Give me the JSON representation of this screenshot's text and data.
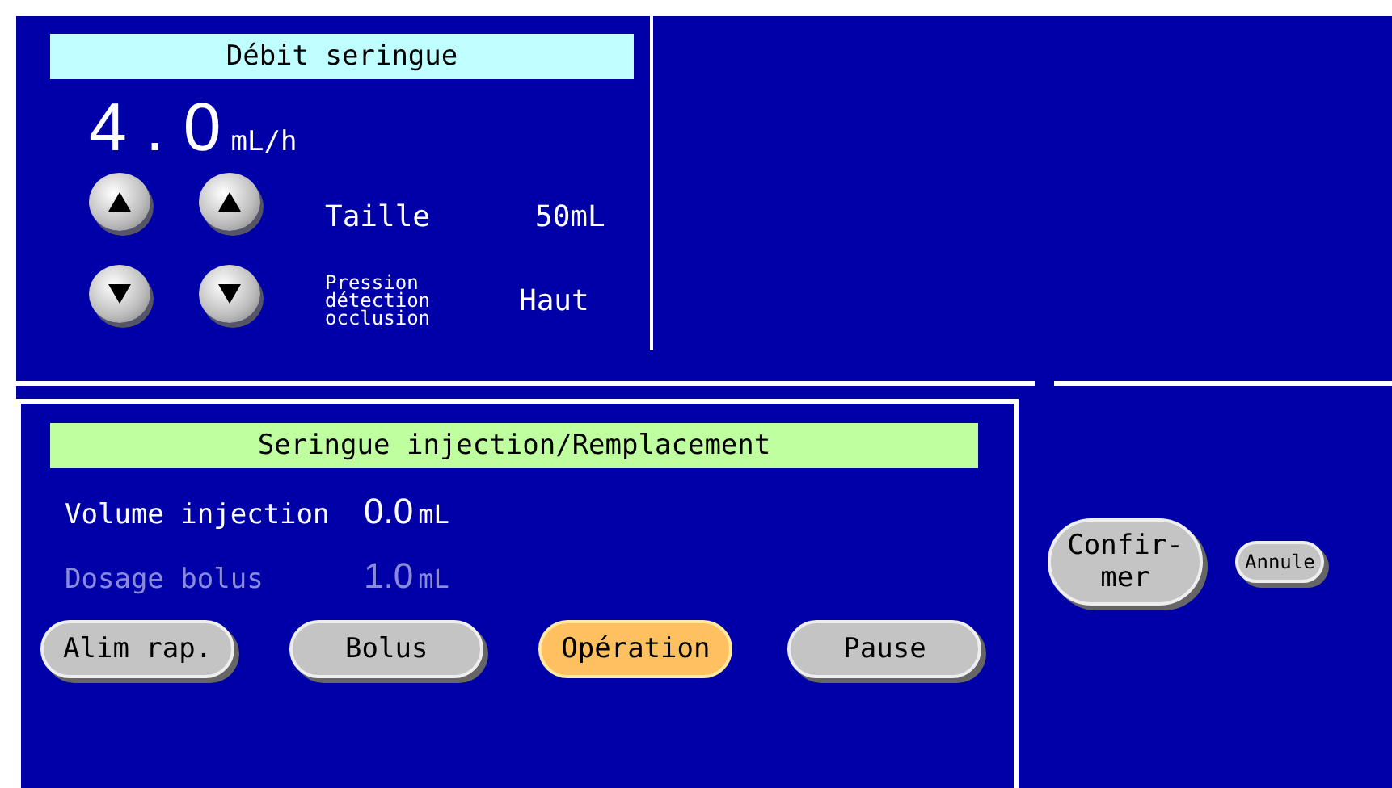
{
  "rate_panel": {
    "title": "Débit seringue",
    "value": "4 . 0",
    "unit": "mL/h",
    "adjust_buttons": [
      {
        "kind": "up"
      },
      {
        "kind": "up"
      },
      {
        "kind": "down"
      },
      {
        "kind": "down"
      }
    ],
    "settings": [
      {
        "label": "Taille",
        "value": "50mL",
        "kind": "normal"
      },
      {
        "label": "Pression détection occlusion",
        "value": "Haut",
        "kind": "small"
      }
    ]
  },
  "injection_panel": {
    "title": "Seringue injection/Remplacement",
    "fields": [
      {
        "label": "Volume injection",
        "value": "0.0",
        "unit": "mL",
        "disabled": false
      },
      {
        "label": "Dosage bolus",
        "value": "1.0",
        "unit": "mL",
        "disabled": true
      }
    ],
    "buttons": [
      {
        "label": "Alim rap.",
        "selected": false
      },
      {
        "label": "Bolus",
        "selected": false
      },
      {
        "label": "Opération",
        "selected": true
      },
      {
        "label": "Pause",
        "selected": false
      }
    ]
  },
  "confirm_buttons": [
    {
      "label": "Confir-\nmer",
      "kind": "large"
    },
    {
      "label": "Annule",
      "kind": "small"
    }
  ]
}
